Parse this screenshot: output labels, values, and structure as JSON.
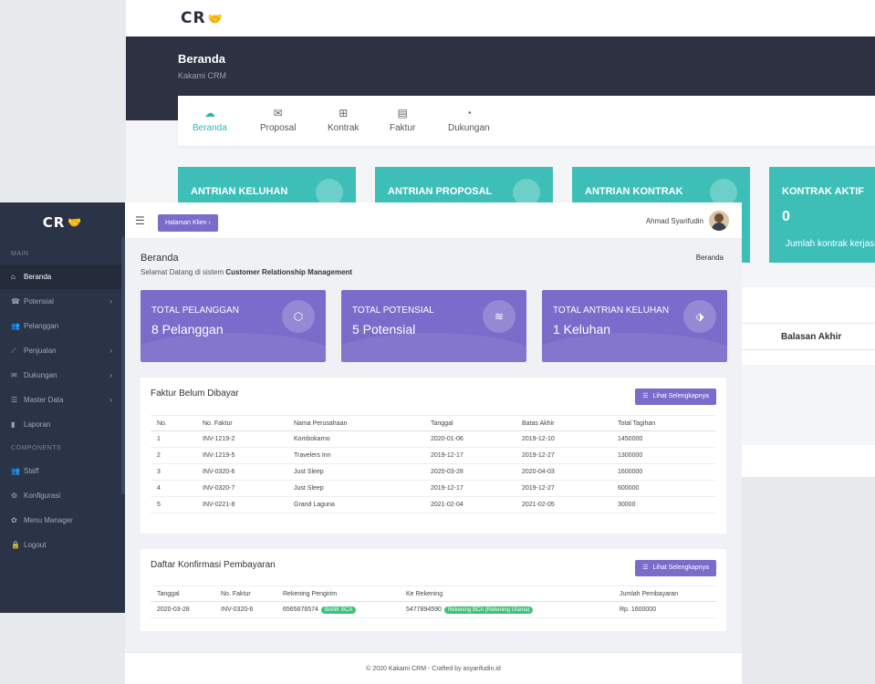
{
  "back": {
    "logo": "CR",
    "hero_title": "Beranda",
    "hero_subtitle": "Kakami CRM",
    "nav": [
      {
        "label": "Beranda",
        "icon": "dashboard-icon",
        "glyph": "☁",
        "active": true
      },
      {
        "label": "Proposal",
        "icon": "mail-icon",
        "glyph": "✉",
        "active": false
      },
      {
        "label": "Kontrak",
        "icon": "contract-icon",
        "glyph": "⊞",
        "active": false
      },
      {
        "label": "Faktur",
        "icon": "invoice-icon",
        "glyph": "▤",
        "active": false
      },
      {
        "label": "Dukungan",
        "icon": "support-icon",
        "glyph": "◔",
        "active": false
      }
    ],
    "cards": [
      {
        "label": "ANTRIAN KELUHAN"
      },
      {
        "label": "ANTRIAN PROPOSAL"
      },
      {
        "label": "ANTRIAN KONTRAK"
      },
      {
        "label": "KONTRAK AKTIF",
        "value": "0",
        "desc": "Jumlah kontrak kerjasa"
      }
    ],
    "table_header": "Balasan Akhir"
  },
  "sidebar": {
    "logo": "CR",
    "section_main": "MAIN",
    "section_components": "COMPONENTS",
    "main_items": [
      {
        "label": "Beranda",
        "icon": "home-icon",
        "glyph": "⌂",
        "active": true,
        "chevron": false
      },
      {
        "label": "Potensial",
        "icon": "phone-icon",
        "glyph": "☎",
        "active": false,
        "chevron": true
      },
      {
        "label": "Pelanggan",
        "icon": "users-icon",
        "glyph": "👥",
        "active": false,
        "chevron": false
      },
      {
        "label": "Penjualan",
        "icon": "chart-line-icon",
        "glyph": "⟋",
        "active": false,
        "chevron": true
      },
      {
        "label": "Dukungan",
        "icon": "mail-icon",
        "glyph": "✉",
        "active": false,
        "chevron": true
      },
      {
        "label": "Master Data",
        "icon": "list-icon",
        "glyph": "☰",
        "active": false,
        "chevron": true
      },
      {
        "label": "Laporan",
        "icon": "bar-chart-icon",
        "glyph": "▮",
        "active": false,
        "chevron": false
      }
    ],
    "component_items": [
      {
        "label": "Staff",
        "icon": "staff-icon",
        "glyph": "👥"
      },
      {
        "label": "Konfigurasi",
        "icon": "user-cog-icon",
        "glyph": "⚙"
      },
      {
        "label": "Menu Manager",
        "icon": "gear-icon",
        "glyph": "✿"
      },
      {
        "label": "Logout",
        "icon": "lock-icon",
        "glyph": "🔒"
      }
    ]
  },
  "topbar": {
    "client_button": "Halaman Klien ›",
    "user_name": "Ahmad Syarifudin"
  },
  "page": {
    "title": "Beranda",
    "subtitle_prefix": "Selamat Datang di sistem ",
    "subtitle_bold": "Customer Relationship Management",
    "breadcrumb": "Beranda"
  },
  "stats": [
    {
      "label": "TOTAL PELANGGAN",
      "value": "8 Pelanggan",
      "icon": "cube-icon",
      "glyph": "⬡"
    },
    {
      "label": "TOTAL POTENSIAL",
      "value": "5 Potensial",
      "icon": "layers-icon",
      "glyph": "≋"
    },
    {
      "label": "TOTAL ANTRIAN KELUHAN",
      "value": "1 Keluhan",
      "icon": "tag-icon",
      "glyph": "⬗"
    }
  ],
  "invoices": {
    "title": "Faktur Belum Dibayar",
    "button": "Lihat Selengkapnya",
    "columns": [
      "No.",
      "No. Faktur",
      "Nama Perusahaan",
      "Tanggal",
      "Batas Akhir",
      "Total Tagihan"
    ],
    "rows": [
      [
        "1",
        "INV-1219-2",
        "Kombokarno",
        "2020-01-06",
        "2019-12-10",
        "1450000"
      ],
      [
        "2",
        "INV-1219-5",
        "Travelers Inn",
        "2019-12-17",
        "2019-12-27",
        "1300000"
      ],
      [
        "3",
        "INV-0320-6",
        "Just Sleep",
        "2020-03-28",
        "2020-04-03",
        "1600000"
      ],
      [
        "4",
        "INV-0320-7",
        "Just Sleep",
        "2019-12-17",
        "2019-12-27",
        "600000"
      ],
      [
        "5",
        "INV-0221-8",
        "Grand Laguna",
        "2021-02-04",
        "2021-02-05",
        "30000"
      ]
    ]
  },
  "payments": {
    "title": "Daftar Konfirmasi Pembayaran",
    "button": "Lihat Selengkapnya",
    "columns": [
      "Tanggal",
      "No. Faktur",
      "Rekening Pengirim",
      "Ke Rekening",
      "Jumlah Pembayaran"
    ],
    "rows": [
      {
        "date": "2020-03-28",
        "invoice": "INV-0320-6",
        "sender": "6565676574",
        "sender_badge": "BANK BCA",
        "dest": "5477894590",
        "dest_badge": "Rekening BCA (Rekening Utama)",
        "amount": "Rp. 1600000"
      }
    ]
  },
  "footer": "© 2020 Kakami CRM - Crafted by asyarifudin.id",
  "colors": {
    "accent": "#7b6bca",
    "teal": "#3dbfb8",
    "sidebar": "#2b3447",
    "hero": "#2d3142",
    "badge": "#3ec27a"
  }
}
